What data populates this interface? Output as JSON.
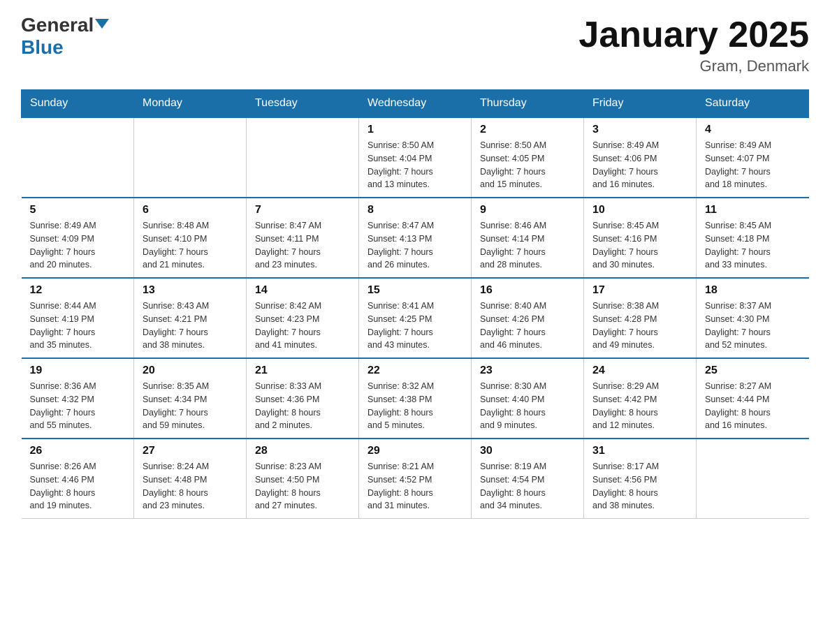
{
  "header": {
    "logo_general": "General",
    "logo_blue": "Blue",
    "month_title": "January 2025",
    "location": "Gram, Denmark"
  },
  "weekdays": [
    "Sunday",
    "Monday",
    "Tuesday",
    "Wednesday",
    "Thursday",
    "Friday",
    "Saturday"
  ],
  "weeks": [
    [
      {
        "day": "",
        "info": ""
      },
      {
        "day": "",
        "info": ""
      },
      {
        "day": "",
        "info": ""
      },
      {
        "day": "1",
        "info": "Sunrise: 8:50 AM\nSunset: 4:04 PM\nDaylight: 7 hours\nand 13 minutes."
      },
      {
        "day": "2",
        "info": "Sunrise: 8:50 AM\nSunset: 4:05 PM\nDaylight: 7 hours\nand 15 minutes."
      },
      {
        "day": "3",
        "info": "Sunrise: 8:49 AM\nSunset: 4:06 PM\nDaylight: 7 hours\nand 16 minutes."
      },
      {
        "day": "4",
        "info": "Sunrise: 8:49 AM\nSunset: 4:07 PM\nDaylight: 7 hours\nand 18 minutes."
      }
    ],
    [
      {
        "day": "5",
        "info": "Sunrise: 8:49 AM\nSunset: 4:09 PM\nDaylight: 7 hours\nand 20 minutes."
      },
      {
        "day": "6",
        "info": "Sunrise: 8:48 AM\nSunset: 4:10 PM\nDaylight: 7 hours\nand 21 minutes."
      },
      {
        "day": "7",
        "info": "Sunrise: 8:47 AM\nSunset: 4:11 PM\nDaylight: 7 hours\nand 23 minutes."
      },
      {
        "day": "8",
        "info": "Sunrise: 8:47 AM\nSunset: 4:13 PM\nDaylight: 7 hours\nand 26 minutes."
      },
      {
        "day": "9",
        "info": "Sunrise: 8:46 AM\nSunset: 4:14 PM\nDaylight: 7 hours\nand 28 minutes."
      },
      {
        "day": "10",
        "info": "Sunrise: 8:45 AM\nSunset: 4:16 PM\nDaylight: 7 hours\nand 30 minutes."
      },
      {
        "day": "11",
        "info": "Sunrise: 8:45 AM\nSunset: 4:18 PM\nDaylight: 7 hours\nand 33 minutes."
      }
    ],
    [
      {
        "day": "12",
        "info": "Sunrise: 8:44 AM\nSunset: 4:19 PM\nDaylight: 7 hours\nand 35 minutes."
      },
      {
        "day": "13",
        "info": "Sunrise: 8:43 AM\nSunset: 4:21 PM\nDaylight: 7 hours\nand 38 minutes."
      },
      {
        "day": "14",
        "info": "Sunrise: 8:42 AM\nSunset: 4:23 PM\nDaylight: 7 hours\nand 41 minutes."
      },
      {
        "day": "15",
        "info": "Sunrise: 8:41 AM\nSunset: 4:25 PM\nDaylight: 7 hours\nand 43 minutes."
      },
      {
        "day": "16",
        "info": "Sunrise: 8:40 AM\nSunset: 4:26 PM\nDaylight: 7 hours\nand 46 minutes."
      },
      {
        "day": "17",
        "info": "Sunrise: 8:38 AM\nSunset: 4:28 PM\nDaylight: 7 hours\nand 49 minutes."
      },
      {
        "day": "18",
        "info": "Sunrise: 8:37 AM\nSunset: 4:30 PM\nDaylight: 7 hours\nand 52 minutes."
      }
    ],
    [
      {
        "day": "19",
        "info": "Sunrise: 8:36 AM\nSunset: 4:32 PM\nDaylight: 7 hours\nand 55 minutes."
      },
      {
        "day": "20",
        "info": "Sunrise: 8:35 AM\nSunset: 4:34 PM\nDaylight: 7 hours\nand 59 minutes."
      },
      {
        "day": "21",
        "info": "Sunrise: 8:33 AM\nSunset: 4:36 PM\nDaylight: 8 hours\nand 2 minutes."
      },
      {
        "day": "22",
        "info": "Sunrise: 8:32 AM\nSunset: 4:38 PM\nDaylight: 8 hours\nand 5 minutes."
      },
      {
        "day": "23",
        "info": "Sunrise: 8:30 AM\nSunset: 4:40 PM\nDaylight: 8 hours\nand 9 minutes."
      },
      {
        "day": "24",
        "info": "Sunrise: 8:29 AM\nSunset: 4:42 PM\nDaylight: 8 hours\nand 12 minutes."
      },
      {
        "day": "25",
        "info": "Sunrise: 8:27 AM\nSunset: 4:44 PM\nDaylight: 8 hours\nand 16 minutes."
      }
    ],
    [
      {
        "day": "26",
        "info": "Sunrise: 8:26 AM\nSunset: 4:46 PM\nDaylight: 8 hours\nand 19 minutes."
      },
      {
        "day": "27",
        "info": "Sunrise: 8:24 AM\nSunset: 4:48 PM\nDaylight: 8 hours\nand 23 minutes."
      },
      {
        "day": "28",
        "info": "Sunrise: 8:23 AM\nSunset: 4:50 PM\nDaylight: 8 hours\nand 27 minutes."
      },
      {
        "day": "29",
        "info": "Sunrise: 8:21 AM\nSunset: 4:52 PM\nDaylight: 8 hours\nand 31 minutes."
      },
      {
        "day": "30",
        "info": "Sunrise: 8:19 AM\nSunset: 4:54 PM\nDaylight: 8 hours\nand 34 minutes."
      },
      {
        "day": "31",
        "info": "Sunrise: 8:17 AM\nSunset: 4:56 PM\nDaylight: 8 hours\nand 38 minutes."
      },
      {
        "day": "",
        "info": ""
      }
    ]
  ]
}
